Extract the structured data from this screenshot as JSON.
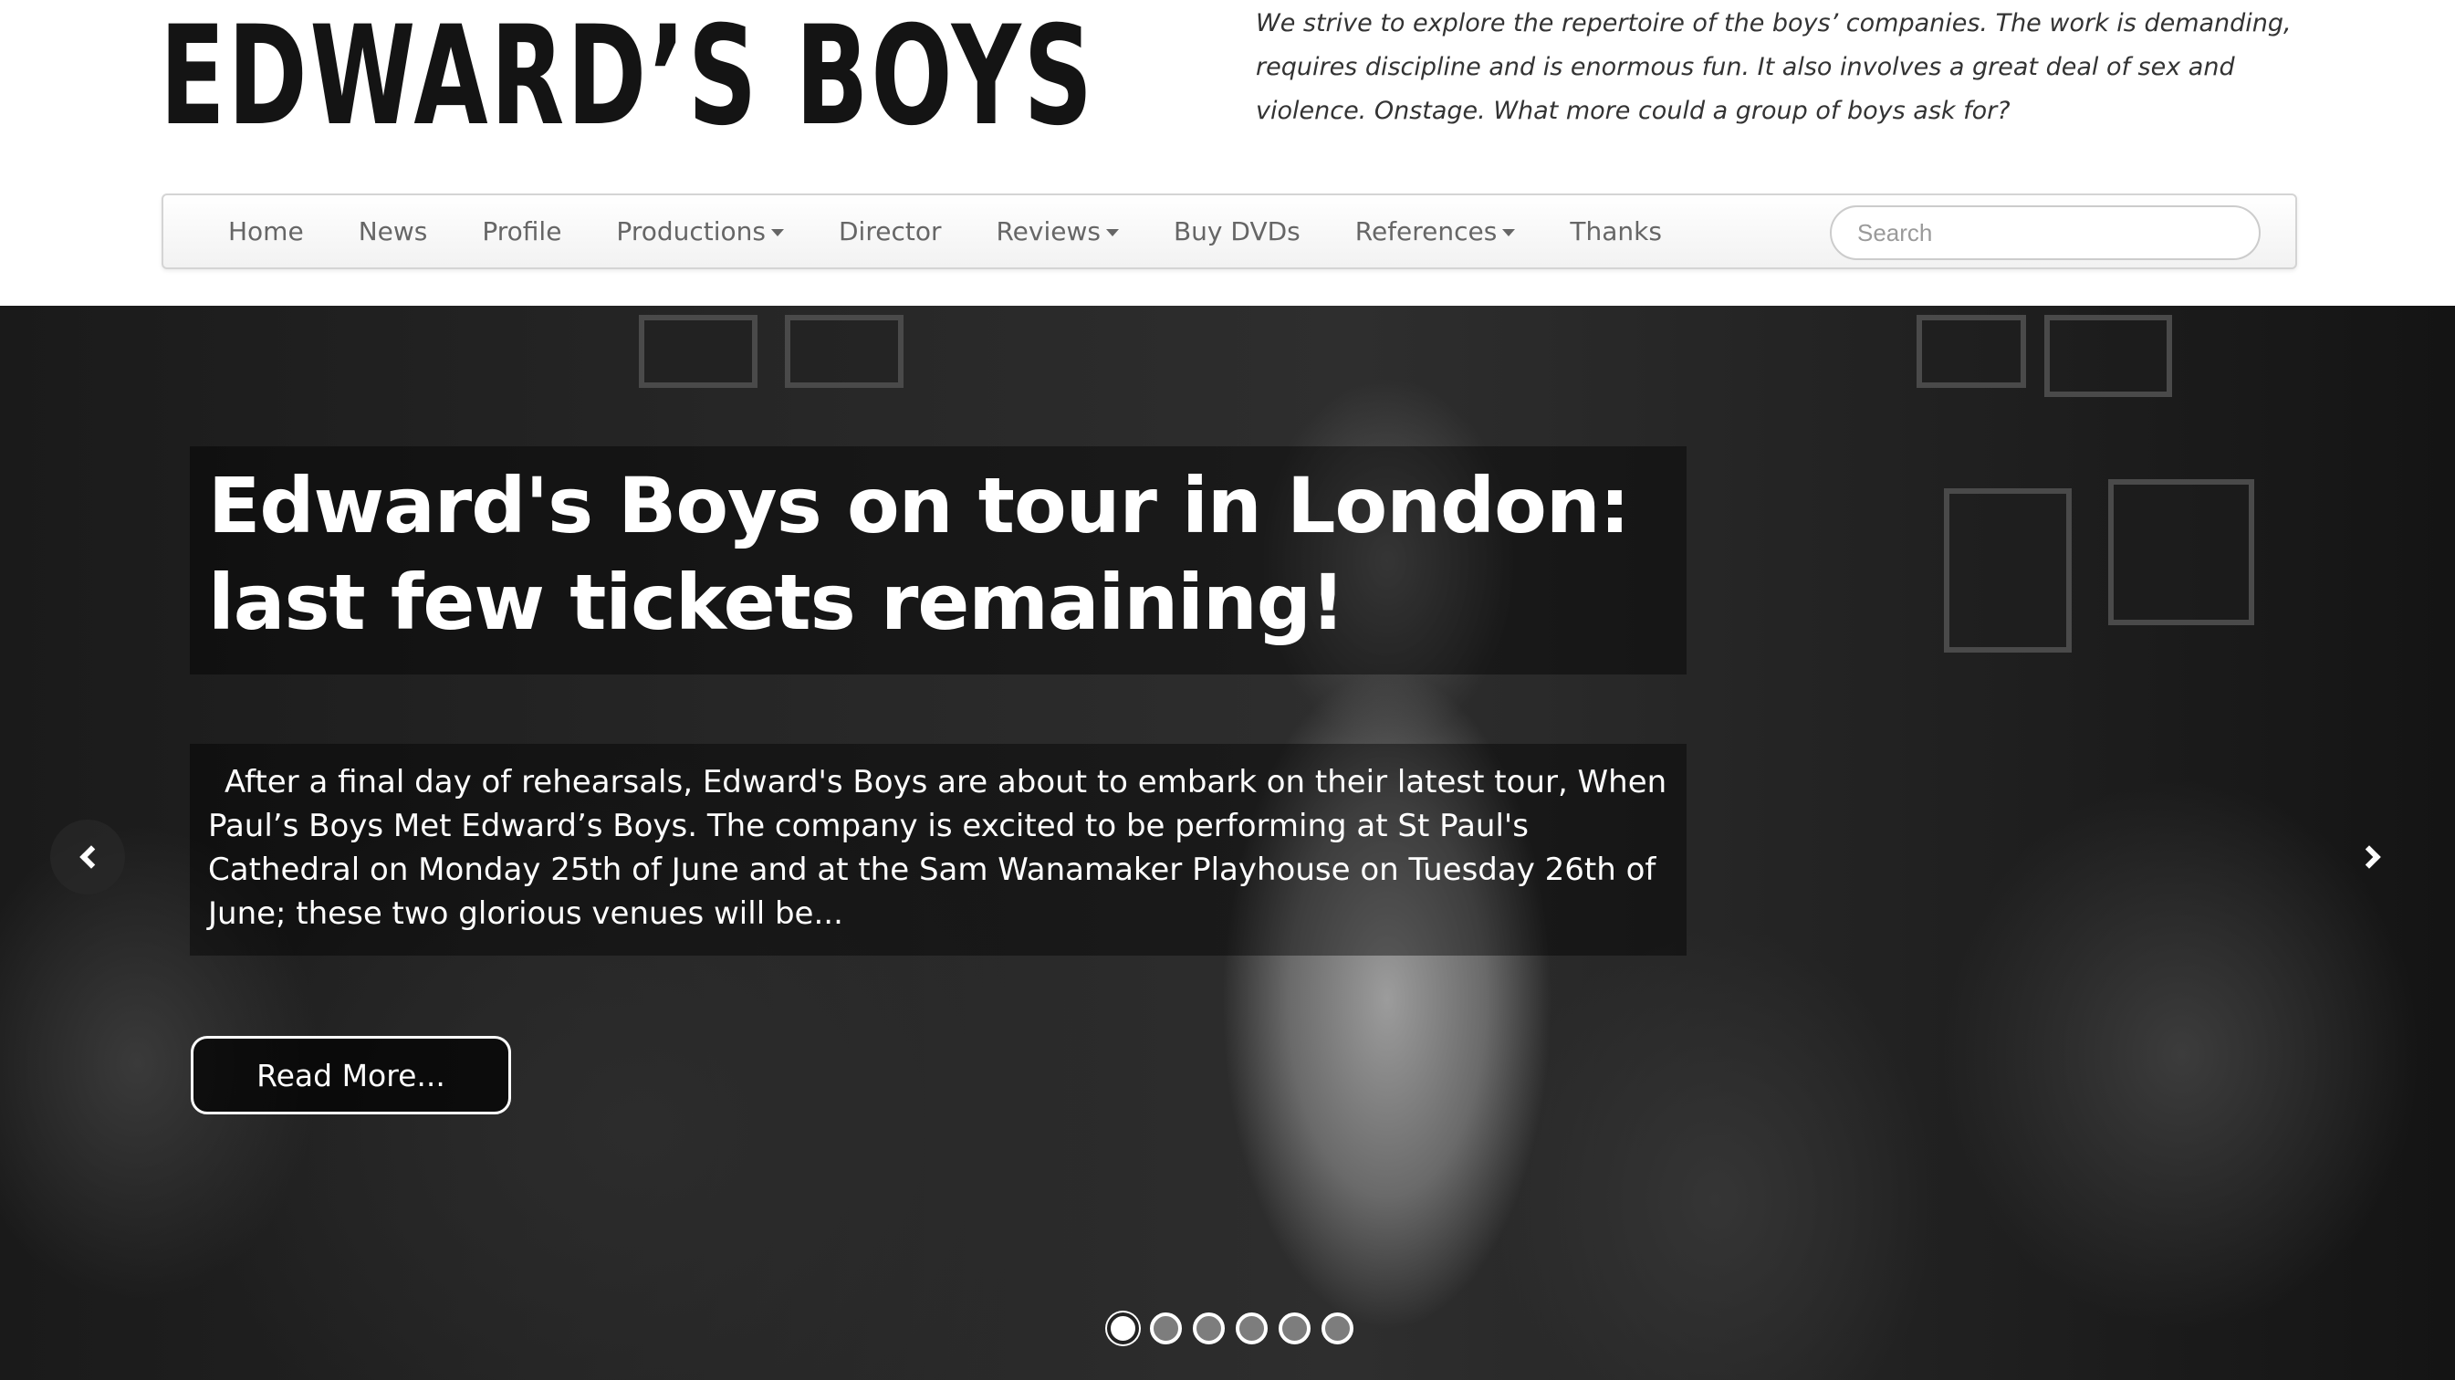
{
  "header": {
    "logo_text": "EDWARD’S BOYS",
    "tagline": "We strive to explore the repertoire of the boys’ companies. The work is demanding, requires discipline and is enormous fun. It also involves a great deal of sex and violence. Onstage. What more could a group of boys ask for?"
  },
  "nav": {
    "items": [
      {
        "label": "Home",
        "dropdown": false
      },
      {
        "label": "News",
        "dropdown": false
      },
      {
        "label": "Profile",
        "dropdown": false
      },
      {
        "label": "Productions",
        "dropdown": true
      },
      {
        "label": "Director",
        "dropdown": false
      },
      {
        "label": "Reviews",
        "dropdown": true
      },
      {
        "label": "Buy DVDs",
        "dropdown": false
      },
      {
        "label": "References",
        "dropdown": true
      },
      {
        "label": "Thanks",
        "dropdown": false
      }
    ],
    "search_placeholder": "Search"
  },
  "carousel": {
    "title": "Edward's Boys on tour in London: last few tickets remaining!",
    "excerpt": "After a final day of rehearsals, Edward's Boys are about to embark on their latest tour, When Paul’s Boys Met Edward’s Boys. The company is excited to be performing at St Paul's Cathedral on Monday 25th of June and at the Sam Wanamaker Playhouse on Tuesday 26th of June; these two glorious venues will be...",
    "button_label": "Read More...",
    "prev_icon": "chevron-left-icon",
    "next_icon": "chevron-right-icon",
    "slide_count": 6,
    "active_slide": 1
  },
  "colors": {
    "nav_text": "#666666",
    "logo": "#141414",
    "overlay_text": "#ffffff"
  }
}
